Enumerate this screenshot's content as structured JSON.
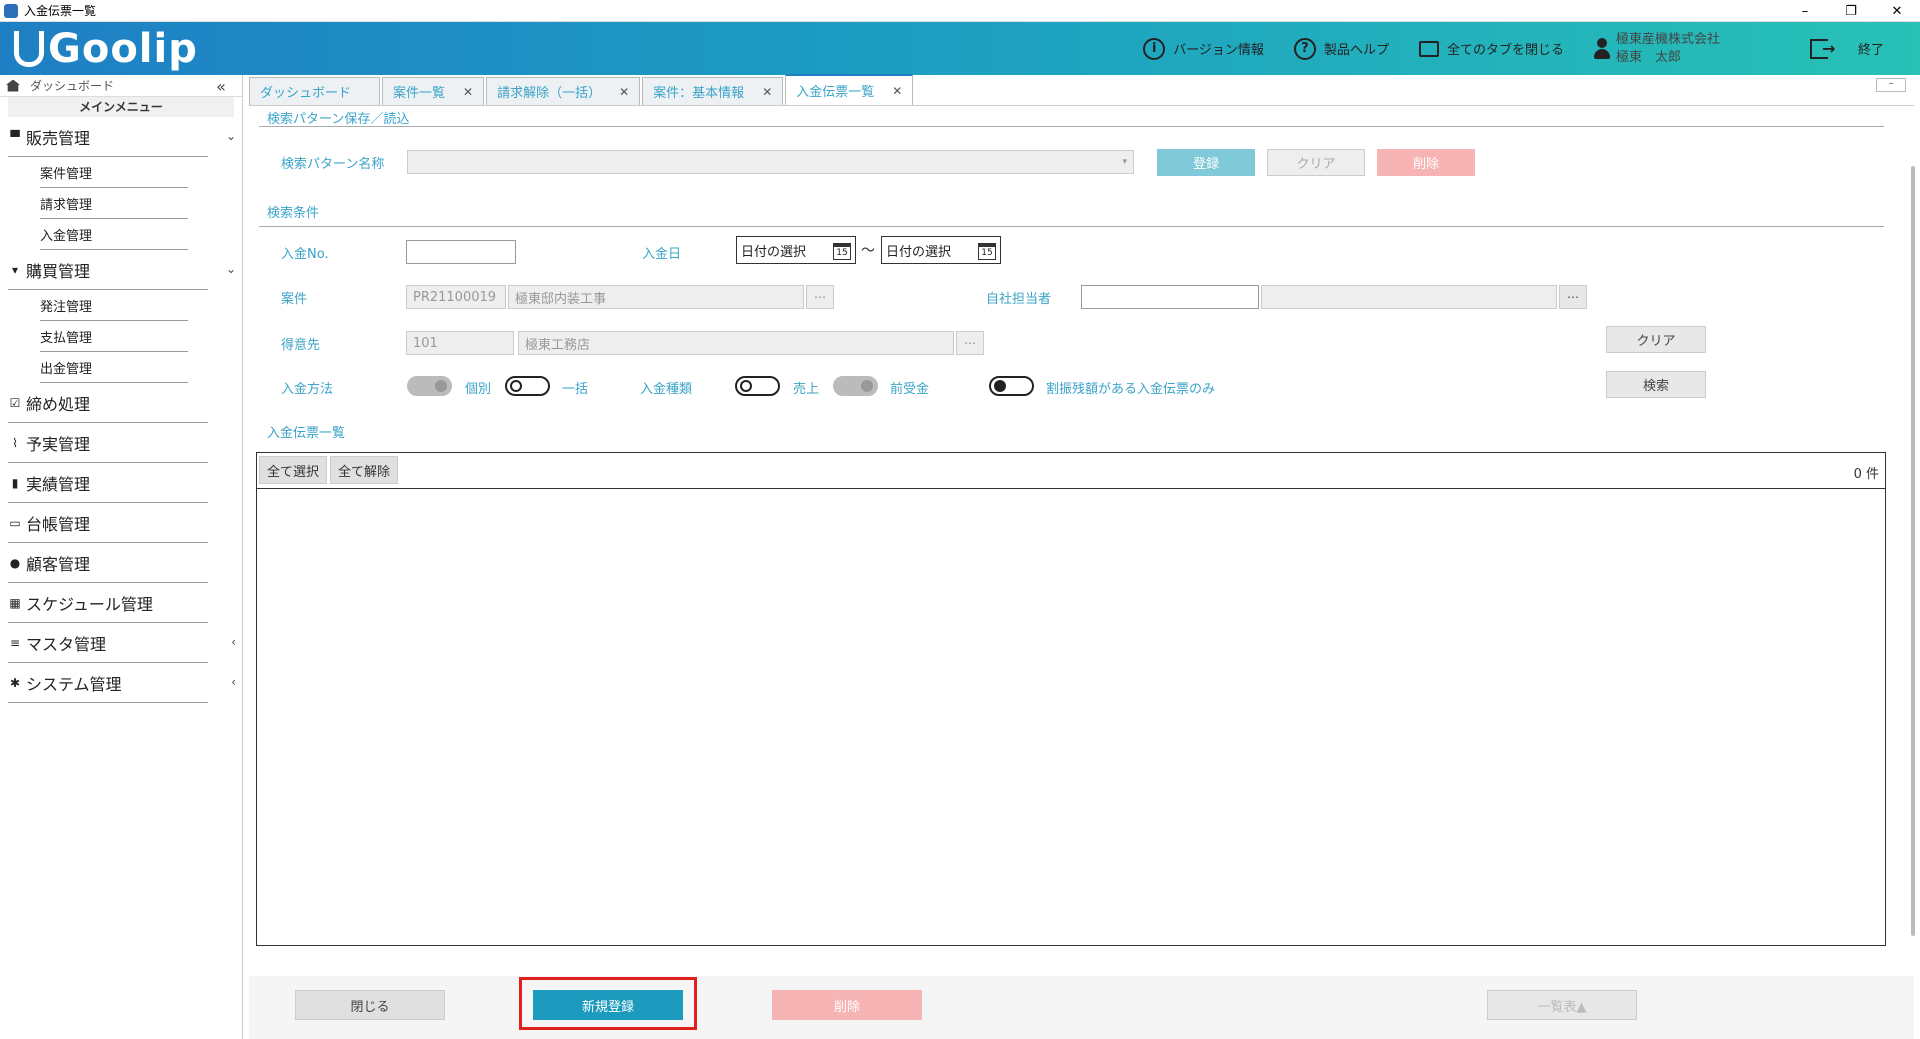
{
  "window": {
    "title": "入金伝票一覧",
    "min": "–",
    "restore": "❐",
    "close": "✕"
  },
  "header": {
    "logo": "Goolip",
    "version_info": "バージョン情報",
    "product_help": "製品ヘルプ",
    "close_all_tabs": "全てのタブを閉じる",
    "company": "極東産機株式会社",
    "user": "極東　太郎",
    "exit": "終了",
    "info_glyph": "i",
    "help_glyph": "?"
  },
  "sidebar": {
    "dashboard": "ダッシュボード",
    "collapse_glyph": "«",
    "main_menu": "メインメニュー",
    "groups": [
      {
        "label": "販売管理",
        "icon": "▀",
        "chev": "⌄",
        "subs": [
          "案件管理",
          "請求管理",
          "入金管理"
        ]
      },
      {
        "label": "購買管理",
        "icon": "▾",
        "chev": "⌄",
        "subs": [
          "発注管理",
          "支払管理",
          "出金管理"
        ]
      },
      {
        "label": "締め処理",
        "icon": "☑",
        "chev": "",
        "subs": []
      },
      {
        "label": "予実管理",
        "icon": "⌇",
        "chev": "",
        "subs": []
      },
      {
        "label": "実績管理",
        "icon": "▮",
        "chev": "",
        "subs": []
      },
      {
        "label": "台帳管理",
        "icon": "▭",
        "chev": "",
        "subs": []
      },
      {
        "label": "顧客管理",
        "icon": "●",
        "chev": "",
        "subs": []
      },
      {
        "label": "スケジュール管理",
        "icon": "▦",
        "chev": "",
        "subs": []
      },
      {
        "label": "マスタ管理",
        "icon": "≡",
        "chev": "‹",
        "subs": []
      },
      {
        "label": "システム管理",
        "icon": "✱",
        "chev": "‹",
        "subs": []
      }
    ]
  },
  "tabs": {
    "items": [
      {
        "label": "ダッシュボード",
        "close": ""
      },
      {
        "label": "案件一覧",
        "close": "✕"
      },
      {
        "label": "請求解除（一括）",
        "close": "✕"
      },
      {
        "label": "案件：基本情報",
        "close": "✕"
      },
      {
        "label": "入金伝票一覧",
        "close": "✕"
      }
    ],
    "minimize": "–"
  },
  "search_pattern": {
    "section": "検索パターン保存／読込",
    "name_label": "検索パターン名称",
    "name_value": "",
    "register": "登録",
    "clear": "クリア",
    "delete": "削除"
  },
  "conditions": {
    "section": "検索条件",
    "no_label": "入金No.",
    "no_value": "",
    "date_label": "入金日",
    "date_from": "日付の選択",
    "date_to": "日付の選択",
    "date_sep": "～",
    "cal_glyph": "15",
    "project_label": "案件",
    "project_code": "PR21100019",
    "project_name": "極東邸内装工事",
    "owner_label": "自社担当者",
    "owner_code": "",
    "owner_name": "",
    "customer_label": "得意先",
    "customer_code": "101",
    "customer_name": "極東工務店",
    "dots": "⋯",
    "clear": "クリア",
    "method_label": "入金方法",
    "method_individual": "個別",
    "method_bulk": "一括",
    "type_label": "入金種類",
    "type_sales": "売上",
    "type_advance": "前受金",
    "balance_only": "割振残額がある入金伝票のみ",
    "search": "検索"
  },
  "list": {
    "section": "入金伝票一覧",
    "select_all": "全て選択",
    "deselect_all": "全て解除",
    "count": "0 件"
  },
  "footer": {
    "close": "閉じる",
    "new": "新規登録",
    "delete": "削除",
    "list_output": "一覧表▲"
  },
  "colors": {
    "accent": "#3aa3c9",
    "primary_button": "#1c9bbf",
    "register_button": "#7fc9d9",
    "delete_button": "#f7b4b4",
    "highlight": "#e0201c"
  }
}
